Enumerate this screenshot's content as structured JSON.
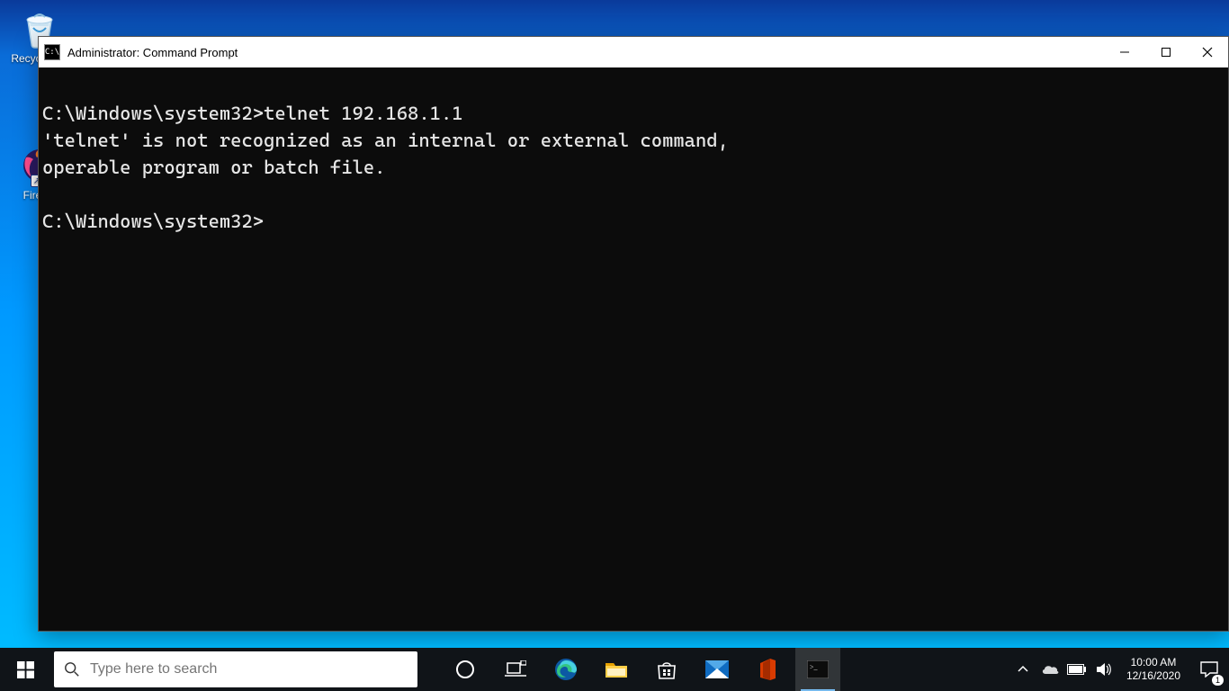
{
  "desktop": {
    "icons": {
      "recycle_bin": "Recycle Bin",
      "firefox": "Firefox"
    }
  },
  "cmd": {
    "title": "Administrator: Command Prompt",
    "lines": [
      "C:\\Windows\\system32>telnet 192.168.1.1",
      "'telnet' is not recognized as an internal or external command,",
      "operable program or batch file.",
      "",
      "C:\\Windows\\system32>"
    ]
  },
  "taskbar": {
    "search_placeholder": "Type here to search",
    "time": "10:00 AM",
    "date": "12/16/2020",
    "notification_count": "1"
  }
}
